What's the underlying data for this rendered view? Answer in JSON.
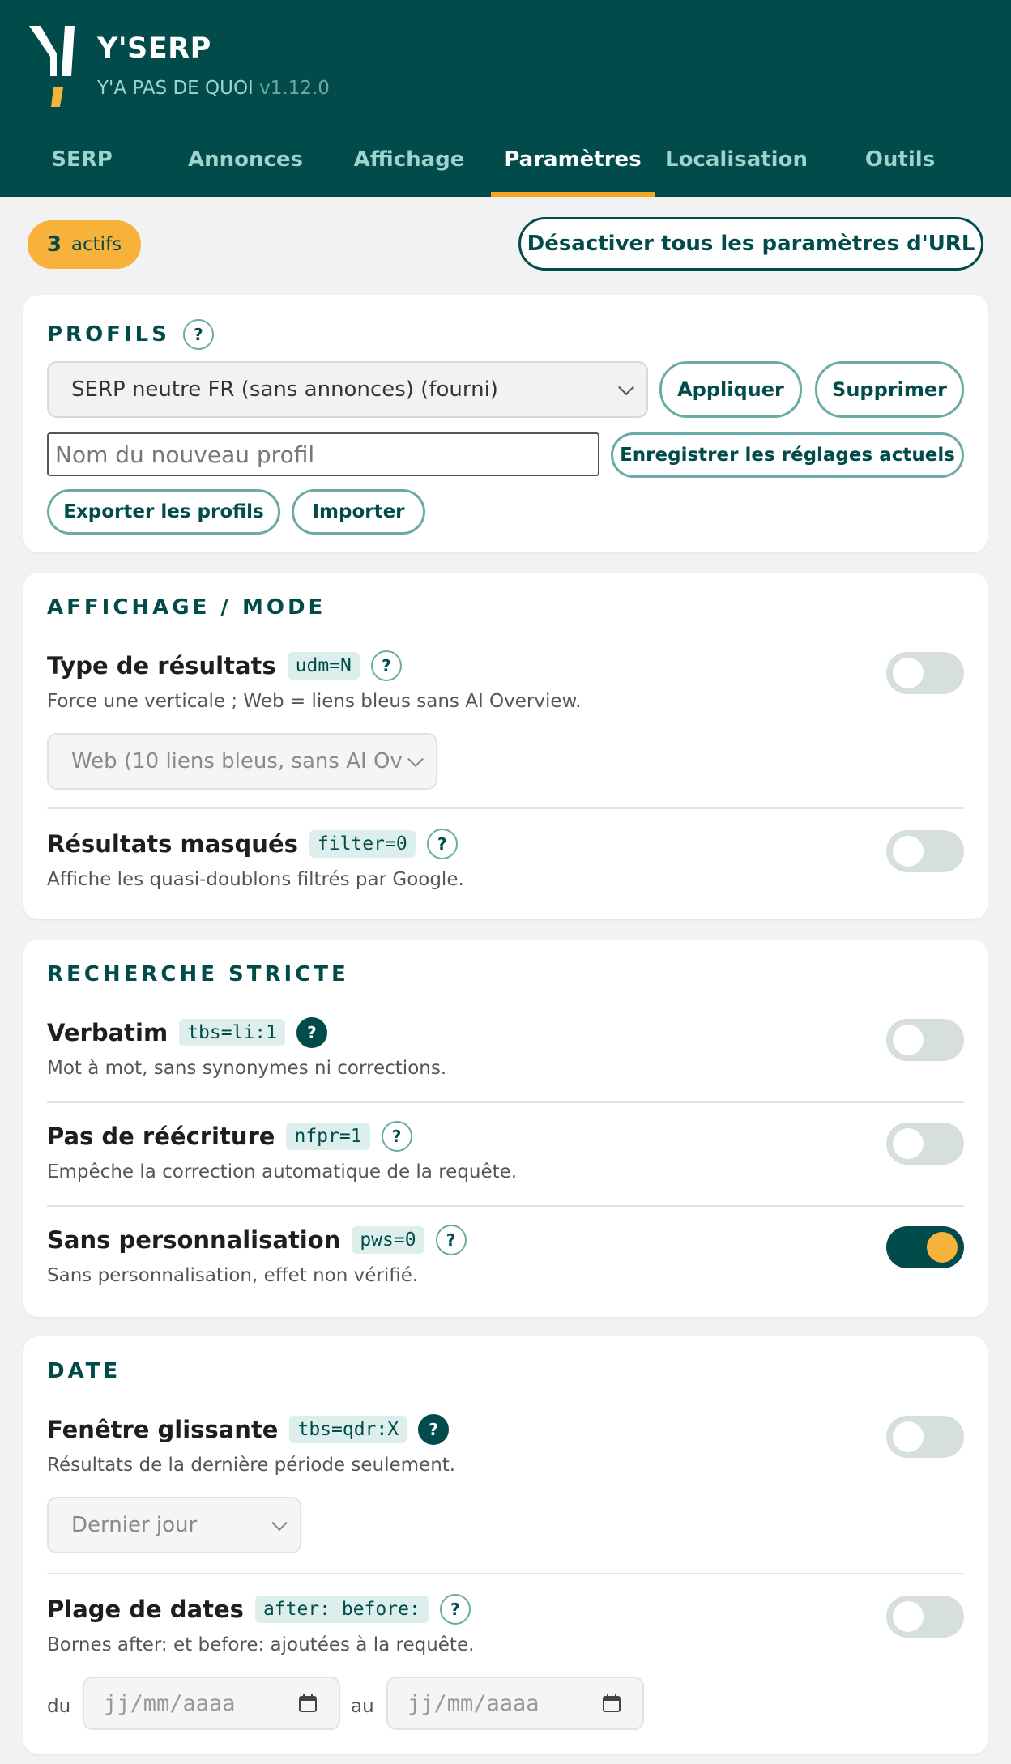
{
  "app": {
    "title": "Y'SERP",
    "subtitle": "Y'A PAS DE QUOI",
    "version": "v1.12.0"
  },
  "tabs": [
    {
      "label": "SERP",
      "active": false
    },
    {
      "label": "Annonces",
      "active": false
    },
    {
      "label": "Affichage",
      "active": false
    },
    {
      "label": "Paramètres",
      "active": true
    },
    {
      "label": "Localisation",
      "active": false
    },
    {
      "label": "Outils",
      "active": false
    }
  ],
  "toolbar": {
    "active_count": "3",
    "active_label": "actifs",
    "disable_all_label": "Désactiver tous les paramètres d'URL"
  },
  "profiles": {
    "title": "PROFILS",
    "help": "?",
    "selected": "SERP neutre FR (sans annonces) (fourni)",
    "apply_label": "Appliquer",
    "delete_label": "Supprimer",
    "name_placeholder": "Nom du nouveau profil",
    "save_label": "Enregistrer les réglages actuels",
    "export_label": "Exporter les profils",
    "import_label": "Importer"
  },
  "display": {
    "title": "AFFICHAGE / MODE",
    "rows": [
      {
        "title": "Type de résultats",
        "code": "udm=N",
        "desc": "Force une verticale ; Web = liens bleus sans AI Overview.",
        "select": "Web (10 liens bleus, sans AI Ov",
        "enabled": false
      },
      {
        "title": "Résultats masqués",
        "code": "filter=0",
        "desc": "Affiche les quasi-doublons filtrés par Google.",
        "enabled": false
      }
    ]
  },
  "strict": {
    "title": "RECHERCHE STRICTE",
    "rows": [
      {
        "title": "Verbatim",
        "code": "tbs=li:1",
        "desc": "Mot à mot, sans synonymes ni corrections.",
        "enabled": false
      },
      {
        "title": "Pas de réécriture",
        "code": "nfpr=1",
        "desc": "Empêche la correction automatique de la requête.",
        "enabled": false
      },
      {
        "title": "Sans personnalisation",
        "code": "pws=0",
        "desc": "Sans personnalisation, effet non vérifié.",
        "enabled": true
      }
    ]
  },
  "date": {
    "title": "DATE",
    "rows": [
      {
        "title": "Fenêtre glissante",
        "code": "tbs=qdr:X",
        "desc": "Résultats de la dernière période seulement.",
        "select": "Dernier jour",
        "enabled": false
      },
      {
        "title": "Plage de dates",
        "code": "after: before:",
        "desc": "Bornes after: et before: ajoutées à la requête.",
        "from_label": "du",
        "to_label": "au",
        "date_placeholder": "jj/mm/aaaa",
        "enabled": false
      }
    ]
  },
  "colors": {
    "brand": "#024b4b",
    "accent": "#f5a623",
    "badge": "#f7b23b"
  }
}
